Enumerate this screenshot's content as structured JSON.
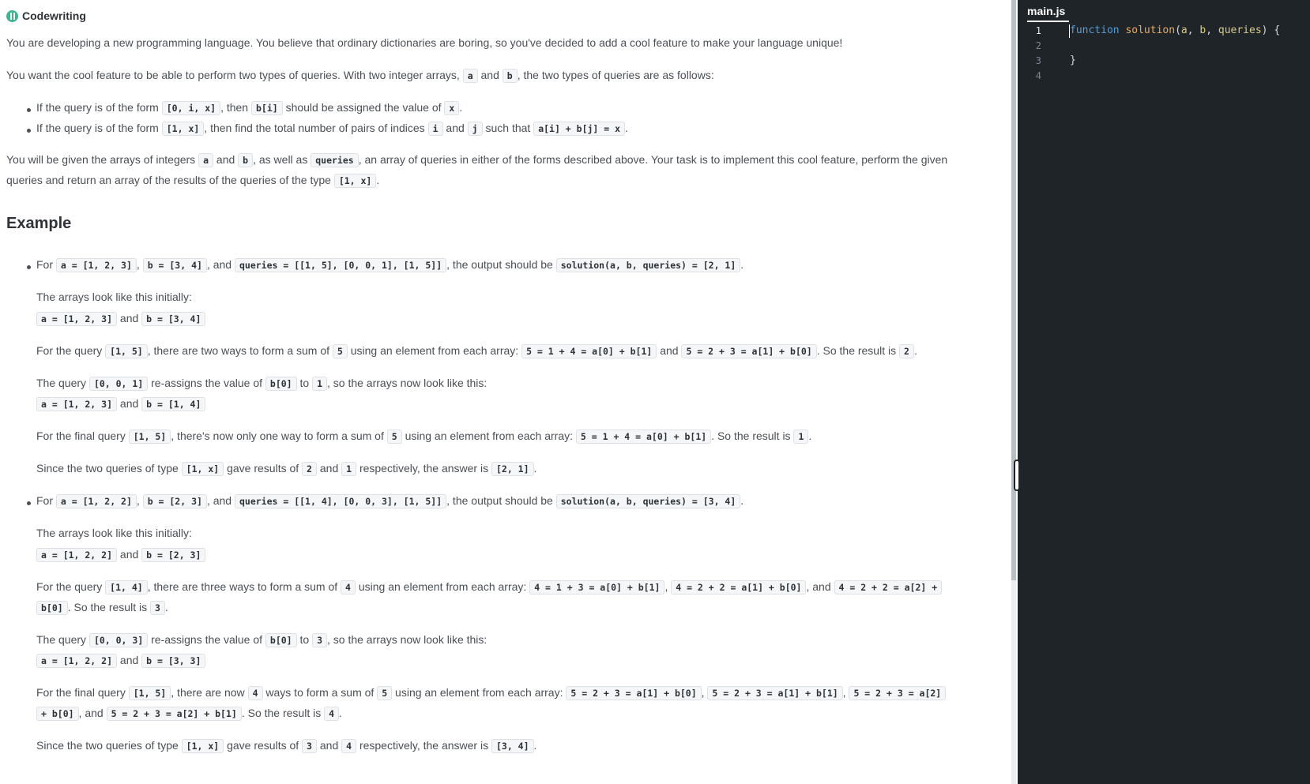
{
  "brand": {
    "name": "Codewriting",
    "logo_icon": "code-brackets-icon"
  },
  "description": {
    "intro": "You are developing a new programming language. You believe that ordinary dictionaries are boring, so you've decided to add a cool feature to make your language unique!",
    "queries_intro": [
      "You want the cool feature to be able to perform two types of queries. With two integer arrays, ",
      "a",
      " and ",
      "b",
      ", the two types of queries are as follows:"
    ],
    "query_types": [
      [
        "If the query is of the form ",
        "[0, i, x]",
        ", then ",
        "b[i]",
        " should be assigned the value of ",
        "x",
        "."
      ],
      [
        "If the query is of the form ",
        "[1, x]",
        ", then find the total number of pairs of indices ",
        "i",
        " and ",
        "j",
        " such that ",
        "a[i] + b[j] = x",
        "."
      ]
    ],
    "task_line1": [
      "You will be given the arrays of integers ",
      "a",
      " and ",
      "b",
      ", as well as ",
      "queries",
      ", an array of queries in either of the forms described above. Your task is to implement this cool feature, perform the given"
    ],
    "task_line2": [
      "queries and return an array of the results of the queries of the type ",
      "[1, x]",
      "."
    ]
  },
  "example": {
    "heading": "Example",
    "ex1": {
      "for_line": [
        "For ",
        "a = [1, 2, 3]",
        ", ",
        "b = [3, 4]",
        ", and ",
        "queries = [[1, 5], [0, 0, 1], [1, 5]]",
        ", the output should be ",
        "solution(a, b, queries) = [2, 1]",
        "."
      ],
      "initial_text": "The arrays look like this initially:",
      "initial_arrays": [
        "a = [1, 2, 3]",
        " and ",
        "b = [3, 4]"
      ],
      "query1": [
        "For the query ",
        "[1, 5]",
        ", there are two ways to form a sum of ",
        "5",
        " using an element from each array: ",
        "5 = 1 + 4 = a[0] + b[1]",
        " and ",
        "5 = 2 + 3 = a[1] + b[0]",
        ". So the result is ",
        "2",
        "."
      ],
      "query2": [
        "The query ",
        "[0, 0, 1]",
        " re-assigns the value of ",
        "b[0]",
        " to ",
        "1",
        ", so the arrays now look like this:"
      ],
      "after_arrays": [
        "a = [1, 2, 3]",
        " and ",
        "b = [1, 4]"
      ],
      "query3": [
        "For the final query ",
        "[1, 5]",
        ", there's now only one way to form a sum of ",
        "5",
        " using an element from each array: ",
        "5 = 1 + 4 = a[0] + b[1]",
        ". So the result is ",
        "1",
        "."
      ],
      "summary": [
        "Since the two queries of type ",
        "[1, x]",
        " gave results of ",
        "2",
        " and ",
        "1",
        " respectively, the answer is ",
        "[2, 1]",
        "."
      ]
    },
    "ex2": {
      "for_line": [
        "For ",
        "a = [1, 2, 2]",
        ", ",
        "b = [2, 3]",
        ", and ",
        "queries = [[1, 4], [0, 0, 3], [1, 5]]",
        ", the output should be ",
        "solution(a, b, queries) = [3, 4]",
        "."
      ],
      "initial_text": "The arrays look like this initially:",
      "initial_arrays": [
        "a = [1, 2, 2]",
        " and ",
        "b = [2, 3]"
      ],
      "query1_line1": [
        "For the query ",
        "[1, 4]",
        ", there are three ways to form a sum of ",
        "4",
        " using an element from each array: ",
        "4 = 1 + 3 = a[0] + b[1]",
        ", ",
        "4 = 2 + 2 = a[1] + b[0]",
        ", and ",
        "4 = 2 + 2 = a[2] +"
      ],
      "query1_line2": [
        "b[0]",
        ". So the result is ",
        "3",
        "."
      ],
      "query2": [
        "The query ",
        "[0, 0, 3]",
        " re-assigns the value of ",
        "b[0]",
        " to ",
        "3",
        ", so the arrays now look like this:"
      ],
      "after_arrays": [
        "a = [1, 2, 2]",
        " and ",
        "b = [3, 3]"
      ],
      "query3_line1": [
        "For the final query ",
        "[1, 5]",
        ", there are now ",
        "4",
        " ways to form a sum of ",
        "5",
        " using an element from each array: ",
        "5 = 2 + 3 = a[1] + b[0]",
        ", ",
        "5 = 2 + 3 = a[1] + b[1]",
        ", ",
        "5 = 2 + 3 = a[2]"
      ],
      "query3_line2": [
        "+ b[0]",
        ", and ",
        "5 = 2 + 3 = a[2] + b[1]",
        ". So the result is ",
        "4",
        "."
      ],
      "summary": [
        "Since the two queries of type ",
        "[1, x]",
        " gave results of ",
        "3",
        " and ",
        "4",
        " respectively, the answer is ",
        "[3, 4]",
        "."
      ]
    }
  },
  "editor": {
    "tab_name": "main.js",
    "line_numbers": [
      "1",
      "2",
      "3",
      "4"
    ],
    "code": {
      "line1": {
        "kw": "function",
        "name": "solution",
        "open": "(",
        "p1": "a",
        "sep1": ", ",
        "p2": "b",
        "sep2": ", ",
        "p3": "queries",
        "close": ") {"
      },
      "line3": "}"
    },
    "colors": {
      "background": "#1f2429",
      "keyword": "#569cd6",
      "function": "#e8a95b",
      "params": "#d7c98a"
    }
  }
}
